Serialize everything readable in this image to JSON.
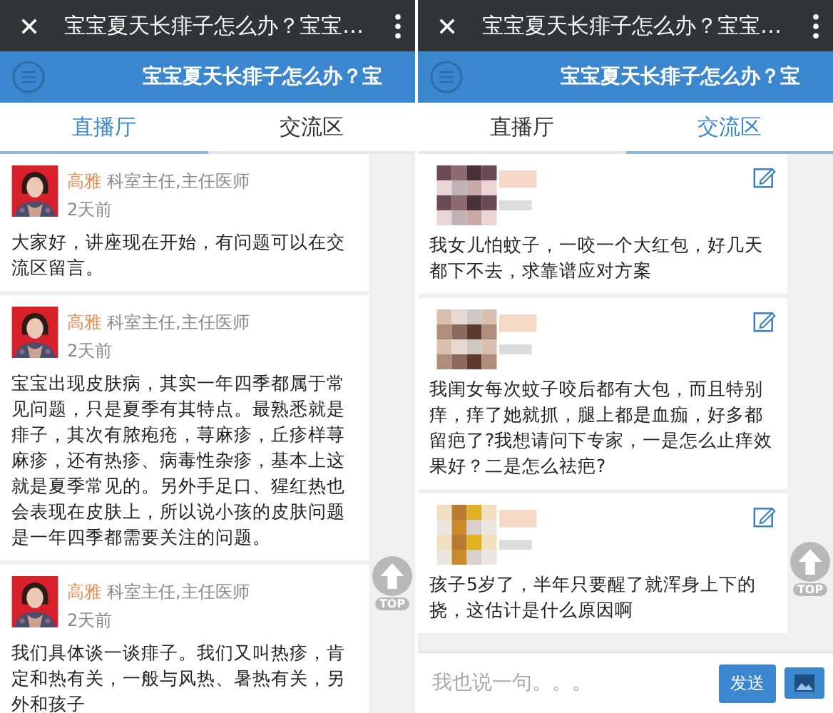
{
  "screens": [
    {
      "window": {
        "title": "宝宝夏天长痱子怎么办？宝宝…"
      },
      "header": {
        "title": "宝宝夏天长痱子怎么办？宝"
      },
      "tabs": [
        {
          "label": "直播厅",
          "selected": true
        },
        {
          "label": "交流区",
          "selected": false
        }
      ],
      "posts": [
        {
          "kind": "doctor",
          "author": "高雅",
          "role": "科室主任,主任医师",
          "time": "2天前",
          "text": "大家好，讲座现在开始，有问题可以在交流区留言。"
        },
        {
          "kind": "doctor",
          "author": "高雅",
          "role": "科室主任,主任医师",
          "time": "2天前",
          "text": "宝宝出现皮肤病，其实一年四季都属于常见问题，只是夏季有其特点。最熟悉就是痱子，其次有脓疱疮，荨麻疹，丘疹样荨麻疹，还有热疹、病毒性杂疹，基本上这就是夏季常见的。另外手足口、猩红热也会表现在皮肤上，所以说小孩的皮肤问题是一年四季都需要关注的问题。"
        },
        {
          "kind": "doctor",
          "author": "高雅",
          "role": "科室主任,主任医师",
          "time": "2天前",
          "text": "我们具体谈一谈痱子。我们又叫热疹，肯定和热有关，一般与风热、暑热有关，另外和孩子"
        }
      ],
      "top_button": "TOP"
    },
    {
      "window": {
        "title": "宝宝夏天长痱子怎么办？宝宝…"
      },
      "header": {
        "title": "宝宝夏天长痱子怎么办？宝"
      },
      "tabs": [
        {
          "label": "直播厅",
          "selected": false
        },
        {
          "label": "交流区",
          "selected": true
        }
      ],
      "posts": [
        {
          "kind": "user",
          "text": "我女儿怕蚊子，一咬一个大红包，好几天都下不去，求靠谱应对方案"
        },
        {
          "kind": "user",
          "text": "我闺女每次蚊子咬后都有大包，而且特别痒，痒了她就抓，腿上都是血痂，好多都留疤了?我想请问下专家，一是怎么止痒效果好？二是怎么祛疤?"
        },
        {
          "kind": "user",
          "text": "孩子5岁了，半年只要醒了就浑身上下的挠，这估计是什么原因啊"
        }
      ],
      "top_button": "TOP",
      "composer": {
        "placeholder": "我也说一句。。。",
        "send": "发送"
      }
    }
  ]
}
